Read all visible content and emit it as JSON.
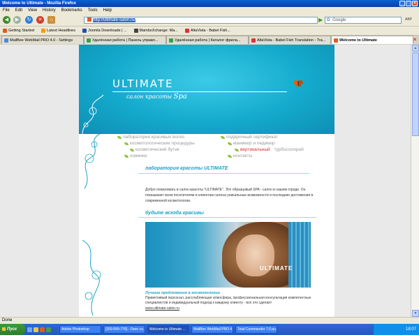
{
  "window": {
    "title": "Welcome to Ultimate - Mozilla Firefox",
    "btn_min": "_",
    "btn_max": "□",
    "btn_close": "×"
  },
  "menu": [
    "File",
    "Edit",
    "View",
    "History",
    "Bookmarks",
    "Tools",
    "Help"
  ],
  "nav": {
    "url": "http://ultimate-salon.ru/",
    "search_placeholder": "Google",
    "search_engine_glyph": "G",
    "go_glyph": "▶",
    "addon_label": "ABP"
  },
  "bookmarks": [
    {
      "label": "Getting Started",
      "color": "#e05a22"
    },
    {
      "label": "Latest Headlines",
      "color": "#ff9800"
    },
    {
      "label": "Joomla Downloads | ...",
      "color": "#1e4fb8"
    },
    {
      "label": "MamboXchange: Ma...",
      "color": "#444"
    },
    {
      "label": "AltaVista - Babel Fish...",
      "color": "#d33"
    }
  ],
  "tabs": [
    {
      "label": "MailBee WebMail PRO 4.0 - Settings",
      "active": false
    },
    {
      "label": "Удалённая работа | Панель управл...",
      "active": false
    },
    {
      "label": "Удалённая работа | Каталог фрила...",
      "active": false
    },
    {
      "label": "AltaVista - Babel Fish Translation - Tra...",
      "active": false
    },
    {
      "label": "Welcome to Ultimate",
      "active": true
    }
  ],
  "tab_close_glyph": "✕",
  "site": {
    "logo": "ULTIMATE",
    "tagline": "салон красоты",
    "spa": "Spa",
    "menu": {
      "col1": [
        "лаборатория красивых волос",
        "косметологические процедуры",
        "косметический бутик",
        "новинки"
      ],
      "col2_1": "подарочный сертификат",
      "col2_2": "маникюр и педикюр",
      "col2_3_red": "вертикальный",
      "col2_3_rest": "турбосолярий",
      "col2_4": "контакты"
    },
    "section1_title": "лаборатория красоты ULTIMATE",
    "section1_text": "Добро пожаловать в салон красоты \"ULTIMATE\". Это образцовый SPA - салон в нашем городе. Он показывает всем посетителям и клиентам салона уникальные возможности и последние достижения в современной косметологии.",
    "section2_title": "будьте всегда красивы",
    "photo_logo": "ULTIMATE",
    "offer_title": "Лучшие предложения в косметологии",
    "offer_text": "Приветливый персонал, расслабляющая атмосфера, профессиональная консультация компетентных специалистов и индивидуальный подход к каждому клиенту - всё это сделает",
    "offer_link": "www.ultimate-salon.ru"
  },
  "status": "Done",
  "taskbar": {
    "start": "Пуск",
    "tasks": [
      {
        "label": "Adobe Photoshop",
        "active": false
      },
      {
        "label": "[209-999-776] - Окно со...",
        "active": false
      },
      {
        "label": "Welcome to Ultimate ...",
        "active": true
      },
      {
        "label": "MailBee WebMail PRO 4...",
        "active": false
      },
      {
        "label": "Total Commander 7.0 pu...",
        "active": false
      }
    ],
    "clock": "18:07"
  }
}
